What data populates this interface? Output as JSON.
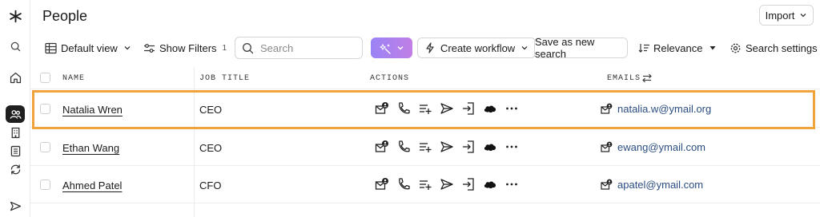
{
  "page": {
    "title": "People"
  },
  "header": {
    "import_label": "Import"
  },
  "toolbar": {
    "default_view_label": "Default view",
    "show_filters_label": "Show Filters",
    "filters_count": "1",
    "search_placeholder": "Search",
    "create_workflow_label": "Create workflow",
    "save_search_label": "Save as new search",
    "relevance_label": "Relevance",
    "search_settings_label": "Search settings"
  },
  "table": {
    "columns": {
      "name": "NAME",
      "job_title": "JOB TITLE",
      "actions": "ACTIONS",
      "emails": "EMAILS"
    },
    "rows": [
      {
        "name": "Natalia Wren",
        "job_title": "CEO",
        "email": "natalia.w@ymail.org"
      },
      {
        "name": "Ethan Wang",
        "job_title": "CEO",
        "email": "ewang@ymail.com"
      },
      {
        "name": "Ahmed Patel",
        "job_title": "CFO",
        "email": "apatel@ymail.com"
      }
    ]
  },
  "colors": {
    "highlight": "#f0a33a",
    "ai_gradient_start": "#9b82f5",
    "ai_gradient_end": "#c07fe6",
    "email_link": "#2b4d82"
  },
  "icons": {
    "rail": [
      "logo-asterisk-icon",
      "search-icon",
      "home-icon",
      "people-icon",
      "building-icon",
      "list-icon",
      "refresh-icon",
      "send-icon"
    ],
    "row_actions": [
      "email-reveal-icon",
      "phone-icon",
      "add-to-list-icon",
      "send-icon",
      "enroll-sequence-icon",
      "salesforce-cloud-icon",
      "more-icon"
    ]
  }
}
